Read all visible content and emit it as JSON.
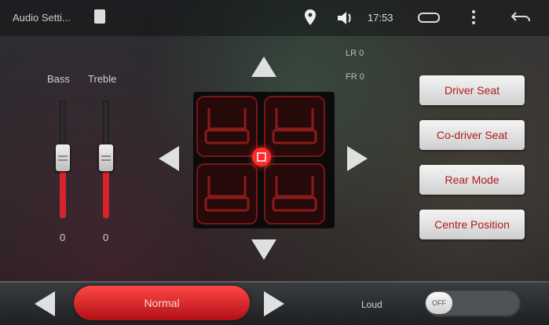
{
  "status_bar": {
    "app_title": "Audio Setti...",
    "time": "17:53"
  },
  "sliders": [
    {
      "label": "Bass",
      "value": "0",
      "level": 0.5
    },
    {
      "label": "Treble",
      "value": "0",
      "level": 0.5
    }
  ],
  "balance": {
    "lr": "LR 0",
    "fr": "FR 0"
  },
  "seat_buttons": [
    {
      "label": "Driver Seat"
    },
    {
      "label": "Co-driver Seat"
    },
    {
      "label": "Rear Mode"
    },
    {
      "label": "Centre Position"
    }
  ],
  "bottom": {
    "eq_mode": "Normal",
    "loud_label": "Loud",
    "loud_toggle_state": "OFF"
  },
  "colors": {
    "accent_red": "#d6242c",
    "button_text": "#b01a1a"
  },
  "icons": [
    "document-icon",
    "location-icon",
    "volume-icon",
    "home-icon",
    "menu-icon",
    "back-icon",
    "arrow-up-icon",
    "arrow-down-icon",
    "arrow-left-icon",
    "arrow-right-icon"
  ]
}
